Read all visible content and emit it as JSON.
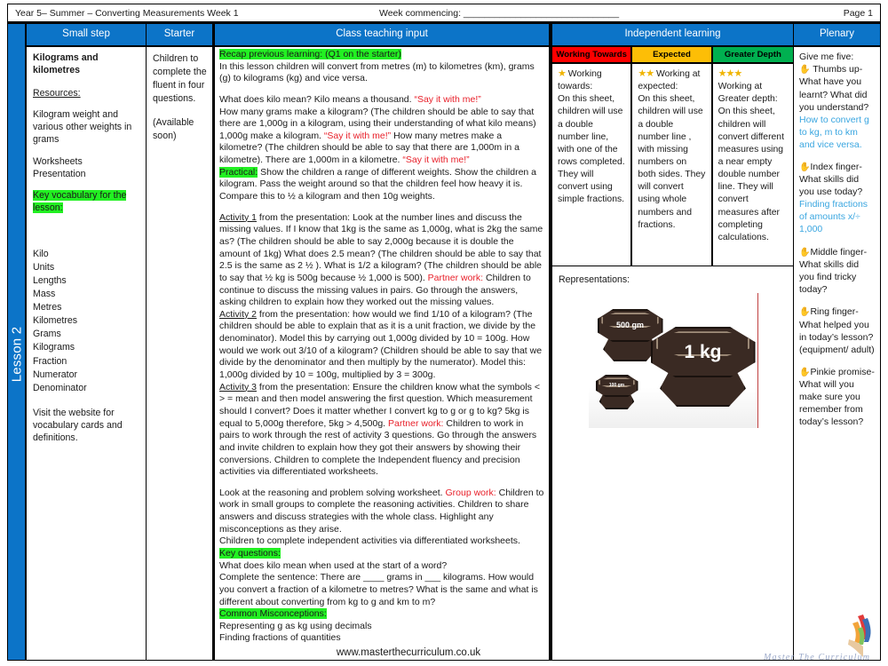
{
  "header": {
    "left": "Year 5– Summer –  Converting Measurements Week 1",
    "middle": "Week commencing: ______________________________",
    "right": "Page 1"
  },
  "spine": {
    "label": "Lesson 2"
  },
  "columns": {
    "small_step": "Small step",
    "starter": "Starter",
    "teaching": "Class teaching input",
    "independent": "Independent learning",
    "plenary": "Plenary"
  },
  "small_step": {
    "title": "Kilograms and kilometres",
    "resources_label": "Resources:",
    "resources": [
      "Kilogram weight and various other weights in grams",
      "Worksheets",
      "Presentation"
    ],
    "worksheets": "Worksheets",
    "presentation": "Presentation",
    "vocab_heading": "Key vocabulary for the lesson:",
    "vocabulary": [
      "Kilo",
      "Units",
      "Lengths",
      "Mass",
      "Metres",
      "Kilometres",
      "Grams",
      "Kilograms",
      "Fraction",
      "Numerator",
      "Denominator"
    ],
    "visit_note": "Visit the website for vocabulary cards and definitions."
  },
  "starter": {
    "line1": "Children to complete the fluent in four questions.",
    "line2": "(Available soon)"
  },
  "teaching": {
    "recap_heading": "Recap previous learning: (Q1 on the starter)",
    "recap_body": "In this lesson children will convert from metres (m) to kilometres (km), grams (g) to kilograms (kg) and vice versa.",
    "kilo_q1": "What does kilo mean? Kilo means a thousand. ",
    "say_it": "“Say it with me!”",
    "kilo_q2": "How many grams make a kilogram? (The children should be able to say that there are 1,000g in a kilogram, using their understanding of what kilo means) 1,000g make a kilogram. ",
    "kilo_q3": " How many metres make a kilometre? (The children should be able to say that there are 1,000m in a kilometre). There are 1,000m in a kilometre. ",
    "practical_label": "Practical:",
    "practical_body": " Show the children a range of different weights. Show the children a kilogram. Pass the weight around so that the children feel how heavy it is. Compare this to ½ a kilogram and then 10g weights.",
    "activity1_label": "Activity 1",
    "activity1_a": " from the presentation: Look at the number lines and discuss the missing values. If I know that 1kg is the same as 1,000g, what is 2kg the same as? (The children should be able to say 2,000g because it is double the amount of 1kg) What does 2.5 mean? (The children should be able to say that 2.5 is the same as 2 ½ ). What is 1/2  a kilogram? (The children should be able to say that ½ kg is 500g because ½ 1,000 is 500). ",
    "partner_work": "Partner work:",
    "activity1_b": " Children to continue to discuss the missing values in pairs. Go through the answers, asking children to explain how they worked out the missing values.",
    "activity2_label": "Activity 2",
    "activity2_a": " from the presentation: how would we find 1/10 of a kilogram? (The children should be able to explain that as it is a unit fraction, we divide by the denominator). Model this by carrying out 1,000g divided by 10 = 100g. How would we work out 3/10 of a kilogram? (Children should be able to say that we divide by the denominator and then multiply by the numerator). Model this: 1,000g divided by 10 = 100g, multiplied by 3 = 300g.",
    "activity3_label": "Activity 3",
    "activity3_a": " from the presentation: Ensure the children know what the symbols < > = mean and then model answering the first question. Which measurement should I convert?  Does it matter whether I convert kg to g or g to kg? 5kg is equal to 5,000g therefore, 5kg > 4,500g. ",
    "activity3_b": " Children to work in pairs to  work through the rest of activity 3 questions. Go through the answers and invite children to explain how they got their answers by showing their conversions. Children to complete the Independent fluency and precision activities via differentiated worksheets.",
    "reasoning_a": "Look at the reasoning and problem solving worksheet. ",
    "group_work": "Group work:",
    "reasoning_b": " Children to work in small groups to complete the reasoning activities. Children to share answers and discuss strategies with the whole class. Highlight any misconceptions as they arise.",
    "independent_note": "Children to complete independent activities via differentiated worksheets.",
    "key_questions_label": "Key questions:",
    "key_questions": [
      "What does kilo mean when used at the start of a word?",
      "Complete the sentence: There are ____ grams in ___ kilograms. How would you convert a fraction of a kilometre to metres? What is the same and what is different about converting from kg to g and km to m?"
    ],
    "misconceptions_label": "Common Misconceptions:",
    "misconceptions": [
      "Representing g as kg using decimals",
      "Finding fractions of quantities"
    ],
    "url": "www.masterthecurriculum.co.uk"
  },
  "independent": {
    "bands": [
      {
        "header": "Working Towards",
        "header_color": "#ff0000",
        "stars": "★",
        "star_count": 1,
        "intro": " Working towards:",
        "body": "On this sheet, children will use a double number line, with one of the rows completed. They will convert using simple fractions."
      },
      {
        "header": "Expected",
        "header_color": "#fdbe06",
        "stars": "★★",
        "star_count": 2,
        "intro": " Working at expected:",
        "body": "On this sheet, children will use a double number line , with missing numbers on both sides. They will convert using whole numbers and fractions."
      },
      {
        "header": "Greater Depth",
        "header_color": "#00b050",
        "stars": "★★★",
        "star_count": 3,
        "intro": "Working at Greater depth:",
        "body": "On this sheet, children will convert different measures using a near empty double number line. They will convert measures after completing calculations."
      }
    ],
    "representations_label": "Representations:",
    "weights": [
      {
        "label": "500 gm",
        "size": "medium"
      },
      {
        "label": "1 kg",
        "size": "large"
      },
      {
        "label": "100 gm",
        "size": "small"
      }
    ]
  },
  "plenary": {
    "intro": "Give me five:",
    "items": [
      {
        "finger": "Thumbs up-",
        "question": "What have you learnt? What did you understand?",
        "answer": "How to convert g to kg, m to km and vice versa."
      },
      {
        "finger": "Index finger-",
        "question": "What skills did you use today?",
        "answer": "Finding fractions of amounts x/÷ 1,000"
      },
      {
        "finger": "Middle finger-",
        "question": "What skills did you find tricky today?",
        "answer": ""
      },
      {
        "finger": "Ring finger-",
        "question": "What helped you in today’s lesson? (equipment/ adult)",
        "answer": ""
      },
      {
        "finger": "Pinkie promise-",
        "question": " What will you make sure you remember from today’s lesson?",
        "answer": ""
      }
    ]
  },
  "footer": {
    "logo_text": "Master The Curriculum"
  },
  "colors": {
    "brand_blue": "#0c74c8",
    "highlight_green": "#22f022",
    "accent_red": "#e8202a",
    "answer_blue": "#3aa6e0",
    "star_gold": "#f0b400"
  }
}
